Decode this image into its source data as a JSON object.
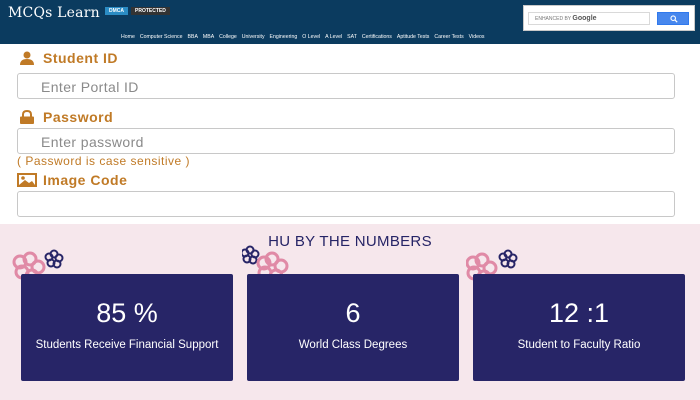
{
  "header": {
    "logo": "MCQs Learn",
    "badge_dmca": "DMCA",
    "badge_protected": "PROTECTED",
    "search": {
      "enhanced_by": "ENHANCED BY",
      "brand": "Google"
    },
    "nav": [
      "Home",
      "Computer Science",
      "BBA",
      "MBA",
      "College",
      "University",
      "Engineering",
      "O Level",
      "A Level",
      "SAT",
      "Certifications",
      "Aptitude Tests",
      "Career Tests",
      "Videos"
    ]
  },
  "form": {
    "student_id_label": "Student ID",
    "student_id_placeholder": "Enter Portal ID",
    "password_label": "Password",
    "password_placeholder": "Enter password",
    "password_hint": "( Password is case sensitive )",
    "image_code_label": "Image Code",
    "image_code_value": ""
  },
  "numbers": {
    "title": "HU BY THE NUMBERS",
    "cards": [
      {
        "value": "85 %",
        "caption": "Students Receive Financial Support"
      },
      {
        "value": "6",
        "caption": "World Class Degrees"
      },
      {
        "value": "12 :1",
        "caption": "Student to Faculty Ratio"
      }
    ]
  },
  "colors": {
    "header_bg": "#0b3b5f",
    "label_orange": "#c07a26",
    "section_bg": "#f6e7ec",
    "card_bg": "#272567",
    "flower_pink": "#e08aa6",
    "flower_navy": "#272567"
  }
}
